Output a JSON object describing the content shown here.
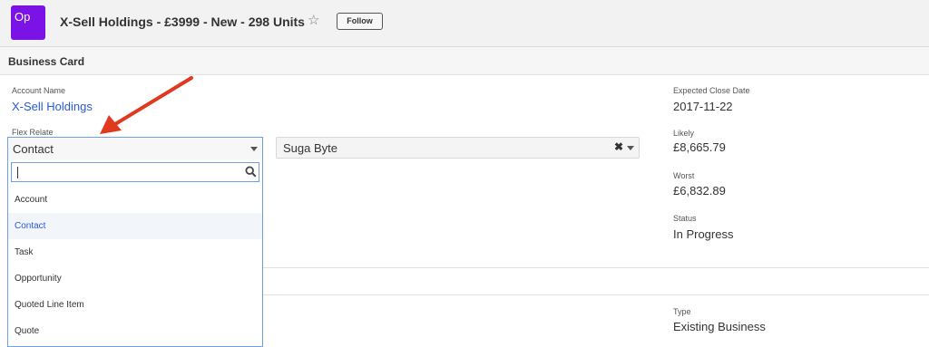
{
  "header": {
    "avatar_text": "Op",
    "record_title": "X-Sell Holdings - £3999 - New - 298 Units",
    "star_icon": "star-outline-icon",
    "follow_label": "Follow"
  },
  "panel": {
    "title": "Business Card"
  },
  "fields": {
    "account_name": {
      "label": "Account Name",
      "value": "X-Sell Holdings"
    },
    "flex_relate": {
      "label": "Flex Relate",
      "selected_type": "Contact",
      "related_record": "Suga Byte",
      "search_value": "",
      "options": [
        "Account",
        "Contact",
        "Task",
        "Opportunity",
        "Quoted Line Item",
        "Quote"
      ],
      "highlighted": "Contact"
    },
    "expected_close_date": {
      "label": "Expected Close Date",
      "value": "2017-11-22"
    },
    "likely": {
      "label": "Likely",
      "value": "£8,665.79"
    },
    "worst": {
      "label": "Worst",
      "value": "£6,832.89"
    },
    "status": {
      "label": "Status",
      "value": "In Progress"
    },
    "type": {
      "label": "Type",
      "value": "Existing Business"
    }
  },
  "colors": {
    "avatar_bg": "#7b12e6",
    "link": "#2a5ad8",
    "focus_border": "#6da0e6",
    "annotation_arrow": "#e0391f"
  }
}
